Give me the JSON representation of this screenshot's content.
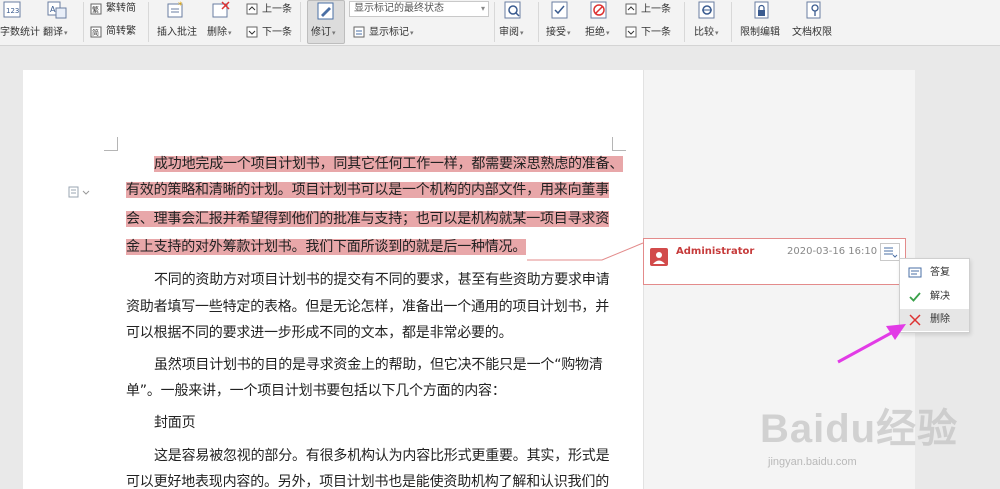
{
  "ribbon": {
    "word_count": "字数统计",
    "translate": "翻译",
    "trad_to_simp": "繁转简",
    "simp_to_trad": "简转繁",
    "insert_comment": "插入批注",
    "delete": "删除",
    "prev_top": "上一条",
    "next_top": "下一条",
    "track_changes": "修订",
    "display_state": "显示标记的最终状态",
    "show_markup": "显示标记",
    "review": "审阅",
    "accept": "接受",
    "reject": "拒绝",
    "prev_change": "上一条",
    "next_change": "下一条",
    "compare": "比较",
    "restrict_edit": "限制编辑",
    "doc_permission": "文档权限"
  },
  "document": {
    "highlighted_lines": [
      "成功地完成一个项目计划书，同其它任何工作一样，都需要深思熟虑的准备、",
      "有效的策略和清晰的计划。项目计划书可以是一个机构的内部文件，用来向董事",
      "会、理事会汇报并希望得到他们的批准与支持；也可以是机构就某一项目寻求资",
      "金上支持的对外筹款计划书。我们下面所谈到的就是后一种情况。"
    ],
    "body_lines": [
      "不同的资助方对项目计划书的提交有不同的要求，甚至有些资助方要求申请",
      "资助者填写一些特定的表格。但是无论怎样，准备出一个通用的项目计划书，并",
      "可以根据不同的要求进一步形成不同的文本，都是非常必要的。",
      "虽然项目计划书的目的是寻求资金上的帮助，但它决不能只是一个“购物清",
      "单”。一般来讲，一个项目计划书要包括以下几个方面的内容：",
      "封面页",
      "这是容易被忽视的部分。有很多机构认为内容比形式更重要。其实，形式是",
      "可以更好地表现内容的。另外，项目计划书也是能使资助机构了解和认识我们的"
    ]
  },
  "comment": {
    "author": "Administrator",
    "timestamp": "2020-03-16 16:10"
  },
  "context_menu": {
    "reply": "答复",
    "resolve": "解决",
    "delete": "删除"
  },
  "watermark": {
    "brand": "Baidu经验",
    "url": "jingyan.baidu.com"
  },
  "colors": {
    "highlight": "#e8a7a9",
    "comment_border": "#e38b8b",
    "author": "#c63b3b",
    "arrow": "#e23be6"
  }
}
